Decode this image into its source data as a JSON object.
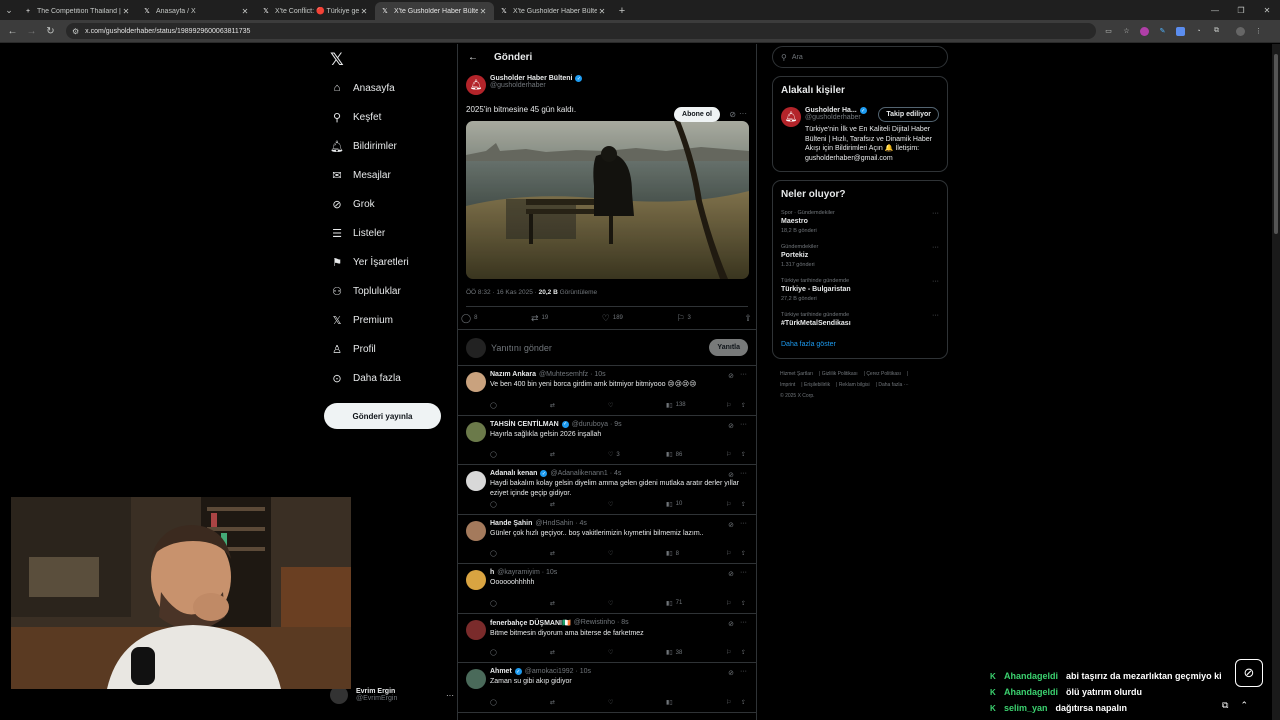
{
  "browser": {
    "tabs": [
      {
        "title": "The Competition Thailand | Mis",
        "icon": "plus-icon",
        "active": false
      },
      {
        "title": "Anasayfa / X",
        "icon": "x-logo-icon",
        "active": false
      },
      {
        "title": "X'te Conflict: 🔴 Türkiye genel",
        "icon": "x-logo-icon",
        "active": false
      },
      {
        "title": "X'te Gusholder Haber Bülteni: \"",
        "icon": "x-logo-icon",
        "active": true
      },
      {
        "title": "X'te Gusholder Haber Bülteni: \"",
        "icon": "x-logo-icon",
        "active": false
      }
    ],
    "url": "x.com/gusholderhaber/status/1989929600063811735"
  },
  "nav": {
    "items": [
      {
        "label": "Anasayfa",
        "icon": "home-icon"
      },
      {
        "label": "Keşfet",
        "icon": "search-icon"
      },
      {
        "label": "Bildirimler",
        "icon": "bell-icon"
      },
      {
        "label": "Mesajlar",
        "icon": "mail-icon"
      },
      {
        "label": "Grok",
        "icon": "grok-icon"
      },
      {
        "label": "Listeler",
        "icon": "list-icon"
      },
      {
        "label": "Yer İşaretleri",
        "icon": "bookmark-icon"
      },
      {
        "label": "Topluluklar",
        "icon": "communities-icon"
      },
      {
        "label": "Premium",
        "icon": "x-logo-icon"
      },
      {
        "label": "Profil",
        "icon": "user-icon"
      },
      {
        "label": "Daha fazla",
        "icon": "more-circle-icon"
      }
    ],
    "post_button": "Gönderi yayınla",
    "account": {
      "name": "Evrim Ergin",
      "handle": "@EvrimErgin"
    }
  },
  "main": {
    "header": "Gönderi",
    "post": {
      "author": "Gusholder Haber Bülteni",
      "handle": "@gusholderhaber",
      "subscribe": "Abone ol",
      "text": "2025'in bitmesine 45 gün kaldı.",
      "time": "ÖÖ 8:32 · 16 Kas 2025 · ",
      "views": "20,2 B",
      "views_label": " Görüntüleme",
      "stats": {
        "replies": "8",
        "reposts": "19",
        "likes": "189",
        "bookmarks": "3"
      }
    },
    "reply_box": {
      "placeholder": "Yanıtını gönder",
      "button": "Yanıtla"
    },
    "replies": [
      {
        "name": "Nazım Ankara",
        "handle": "@Muhtesemhfz · 10s",
        "text": "Ve ben 400 bin yeni borca girdim amk bitmiyor bitmiyooo 😢😢😢😢",
        "replies": "",
        "reposts": "",
        "likes": "",
        "views": "138",
        "avatar_color": "#c9a27e",
        "verified": false
      },
      {
        "name": "TAHSİN CENTİLMAN",
        "handle": "@duruboya · 9s",
        "text": "Hayırla sağlıkla gelsin 2026 inşallah",
        "replies": "",
        "reposts": "",
        "likes": "3",
        "views": "86",
        "avatar_color": "#6b7a4a",
        "verified": true
      },
      {
        "name": "Adanalı kenan",
        "handle": "@Adanalikenann1 · 4s",
        "text": "Haydi bakalım kolay gelsin diyelim amma gelen gideni mutlaka aratır derler yıllar eziyet içinde geçip gidiyor.",
        "replies": "",
        "reposts": "",
        "likes": "",
        "views": "10",
        "avatar_color": "#d8d8d8",
        "verified": true
      },
      {
        "name": "Hande Şahin",
        "handle": "@HndSahin · 4s",
        "text": "Günler çok hızlı geçiyor.. boş vakitlerimizin kıymetini bilmemiz lazım..",
        "replies": "",
        "reposts": "",
        "likes": "",
        "views": "8",
        "avatar_color": "#a47a5c",
        "verified": false
      },
      {
        "name": "h",
        "handle": "@kayramiyim · 10s",
        "text": "Oooooohhhhh",
        "replies": "",
        "reposts": "",
        "likes": "",
        "views": "71",
        "avatar_color": "#d9a441",
        "verified": false
      },
      {
        "name": "fenerbahçe DÜŞMANI🇮🇪",
        "handle": "@Rewistinho · 8s",
        "text": "Bitme bitmesin diyorum ama biterse de farketmez",
        "replies": "",
        "reposts": "",
        "likes": "",
        "views": "38",
        "avatar_color": "#7a2b2b",
        "verified": false
      },
      {
        "name": "Ahmet",
        "handle": "@amokaci1992 · 10s",
        "text": "Zaman su gibi akıp gidiyor",
        "replies": "",
        "reposts": "",
        "likes": "",
        "views": "",
        "avatar_color": "#4a6a5a",
        "verified": true
      }
    ]
  },
  "right": {
    "search_placeholder": "Ara",
    "related": {
      "title": "Alakalı kişiler",
      "name": "Gusholder Ha...",
      "handle": "@gusholderhaber",
      "follow": "Takip ediliyor",
      "bio": "Türkiye'nin İlk ve En Kaliteli Dijital Haber Bülteni | Hızlı, Tarafsız ve Dinamik Haber Akışı için Bildirimleri Açın 🔔 İletişim: gusholderhaber@gmail.com"
    },
    "trends": {
      "title": "Neler oluyor?",
      "items": [
        {
          "category": "Spor · Gündemdekiler",
          "topic": "Maestro",
          "count": "18,2 B gönderi"
        },
        {
          "category": "Gündemdekiler",
          "topic": "Portekiz",
          "count": "1.317 gönderi"
        },
        {
          "category": "Türkiye tarihinde gündemde",
          "topic": "Türkiye - Bulgaristan",
          "count": "27,2 B gönderi"
        },
        {
          "category": "Türkiye tarihinde gündemde",
          "topic": "#TürkMetalSendikası",
          "count": ""
        }
      ],
      "show_more": "Daha fazla göster"
    },
    "footer": [
      "Hizmet Şartları",
      "Gizlilik Politikası",
      "Çerez Politikası",
      "Imprint",
      "Erişilebilirlik",
      "Reklam bilgisi",
      "Daha fazla ···",
      "© 2025 X Corp."
    ]
  },
  "chat": [
    {
      "user": "Ahandageldi",
      "message": "abi taşırız da mezarlıktan geçmiyo ki"
    },
    {
      "user": "Ahandageldi",
      "message": "ölü yatırım olurdu"
    },
    {
      "user": "selim_yan",
      "message": "dağıtırsa napalın"
    }
  ]
}
